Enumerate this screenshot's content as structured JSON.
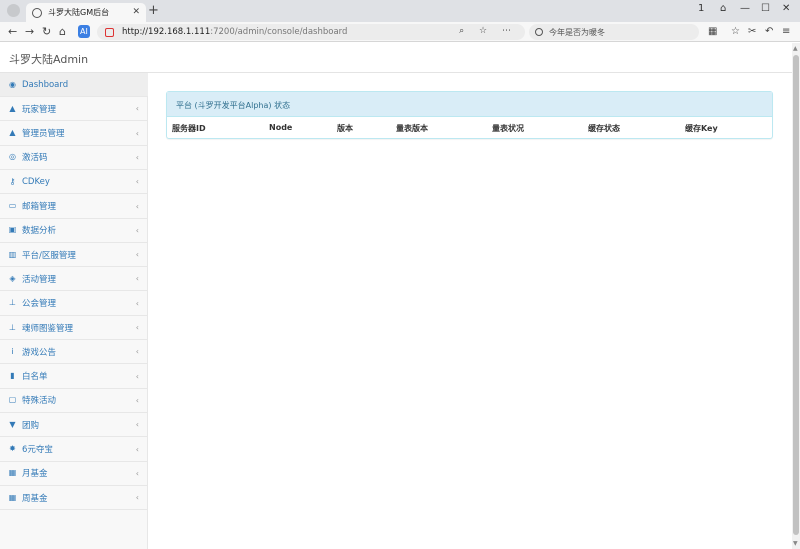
{
  "browser": {
    "tab_title": "斗罗大陆GM后台",
    "tab_close": "✕",
    "new_tab": "+",
    "url_host": "http://192.168.1.111",
    "url_path": ":7200/admin/console/dashboard",
    "search_placeholder": "今年是否为暖冬",
    "win_controls": [
      "1",
      "⌂",
      "—",
      "☐",
      "✕"
    ],
    "nav": [
      "←",
      "→",
      "↻",
      "⌂"
    ],
    "url_tools": "⌕ ☆ ⋯",
    "ext_icons": [
      "▦",
      "☆",
      "✂",
      "↶",
      "≡"
    ]
  },
  "app": {
    "brand": "斗罗大陆Admin"
  },
  "sidebar": {
    "items": [
      {
        "label": "Dashboard",
        "icon": "◉",
        "name": "dashboard",
        "chevron": ""
      },
      {
        "label": "玩家管理",
        "icon": "▲",
        "name": "player-management",
        "chevron": "‹"
      },
      {
        "label": "管理员管理",
        "icon": "▲",
        "name": "admin-management",
        "chevron": "‹"
      },
      {
        "label": "激活码",
        "icon": "◎",
        "name": "activation-code",
        "chevron": "‹"
      },
      {
        "label": "CDKey",
        "icon": "⚷",
        "name": "cdkey",
        "chevron": "‹"
      },
      {
        "label": "邮箱管理",
        "icon": "▭",
        "name": "mailbox-management",
        "chevron": "‹"
      },
      {
        "label": "数据分析",
        "icon": "▣",
        "name": "data-analysis",
        "chevron": "‹"
      },
      {
        "label": "平台/区服管理",
        "icon": "▥",
        "name": "platform-server-management",
        "chevron": "‹"
      },
      {
        "label": "活动管理",
        "icon": "◈",
        "name": "activity-management",
        "chevron": "‹"
      },
      {
        "label": "公会管理",
        "icon": "⊥",
        "name": "guild-management",
        "chevron": "‹"
      },
      {
        "label": "魂师图鉴管理",
        "icon": "⊥",
        "name": "soul-master-atlas-management",
        "chevron": "‹"
      },
      {
        "label": "游戏公告",
        "icon": "ⅰ",
        "name": "game-announcement",
        "chevron": "‹"
      },
      {
        "label": "白名单",
        "icon": "▮",
        "name": "whitelist",
        "chevron": "‹"
      },
      {
        "label": "特殊活动",
        "icon": "▢",
        "name": "special-activity",
        "chevron": "‹"
      },
      {
        "label": "团购",
        "icon": "▼",
        "name": "group-buy",
        "chevron": "‹"
      },
      {
        "label": "6元夺宝",
        "icon": "✸",
        "name": "six-yuan-treasure",
        "chevron": "‹"
      },
      {
        "label": "月基金",
        "icon": "▦",
        "name": "monthly-fund",
        "chevron": "‹"
      },
      {
        "label": "周基金",
        "icon": "▦",
        "name": "weekly-fund",
        "chevron": "‹"
      }
    ]
  },
  "main": {
    "panel_title": "平台 (斗罗开发平台Alpha) 状态",
    "columns": [
      "服务器ID",
      "Node",
      "版本",
      "量表版本",
      "量表状况",
      "缓存状态",
      "缓存Key"
    ]
  },
  "colors": {
    "link": "#337ab7",
    "panel_heading_bg": "#d9edf7",
    "panel_border": "#bce8f1"
  }
}
